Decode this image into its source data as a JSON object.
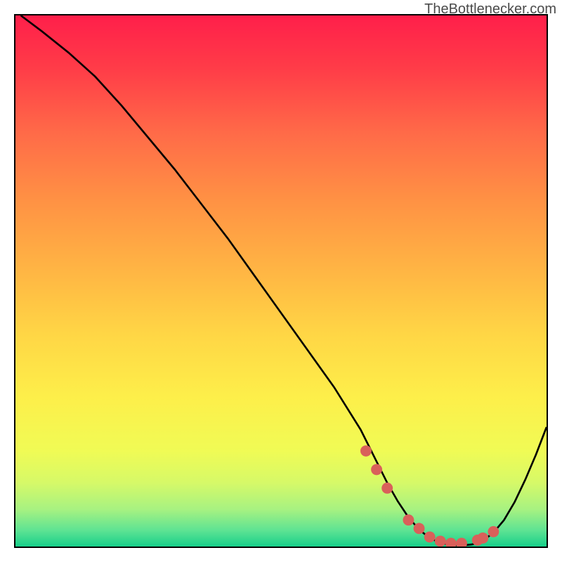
{
  "watermark": "TheBottlenecker.com",
  "chart_data": {
    "type": "line",
    "title": "",
    "xlabel": "",
    "ylabel": "",
    "xlim": [
      0,
      100
    ],
    "ylim": [
      0,
      100
    ],
    "series": [
      {
        "name": "bottleneck-curve",
        "x": [
          1,
          5,
          10,
          15,
          20,
          25,
          30,
          35,
          40,
          45,
          50,
          55,
          60,
          65,
          68,
          70,
          72,
          74,
          76,
          78,
          80,
          82,
          84,
          86,
          88,
          90,
          92,
          94,
          96,
          98,
          100
        ],
        "y": [
          100,
          97,
          93,
          88.5,
          83,
          77,
          71,
          64.5,
          58,
          51,
          44,
          37,
          30,
          22,
          16,
          12,
          8.5,
          5.5,
          3.2,
          1.6,
          0.7,
          0.3,
          0.2,
          0.4,
          1.1,
          2.6,
          5.0,
          8.4,
          12.6,
          17.3,
          22.5
        ]
      }
    ],
    "markers": {
      "name": "highlight-points",
      "color": "#d9605a",
      "x": [
        66,
        68,
        70,
        74,
        76,
        78,
        80,
        82,
        84,
        87,
        88,
        90
      ],
      "y": [
        18,
        14.5,
        11,
        5,
        3.4,
        1.8,
        1.0,
        0.6,
        0.6,
        1.2,
        1.6,
        2.8
      ]
    },
    "background": {
      "type": "vertical-gradient",
      "stops": [
        {
          "pos": 0.0,
          "color": "#ff1f4a"
        },
        {
          "pos": 0.1,
          "color": "#ff3c48"
        },
        {
          "pos": 0.22,
          "color": "#ff6a48"
        },
        {
          "pos": 0.35,
          "color": "#ff9244"
        },
        {
          "pos": 0.48,
          "color": "#ffb544"
        },
        {
          "pos": 0.6,
          "color": "#ffd645"
        },
        {
          "pos": 0.72,
          "color": "#fdef4a"
        },
        {
          "pos": 0.82,
          "color": "#f0fb55"
        },
        {
          "pos": 0.88,
          "color": "#d6f968"
        },
        {
          "pos": 0.93,
          "color": "#a7f281"
        },
        {
          "pos": 0.97,
          "color": "#5de393"
        },
        {
          "pos": 1.0,
          "color": "#17cf8a"
        }
      ]
    }
  }
}
